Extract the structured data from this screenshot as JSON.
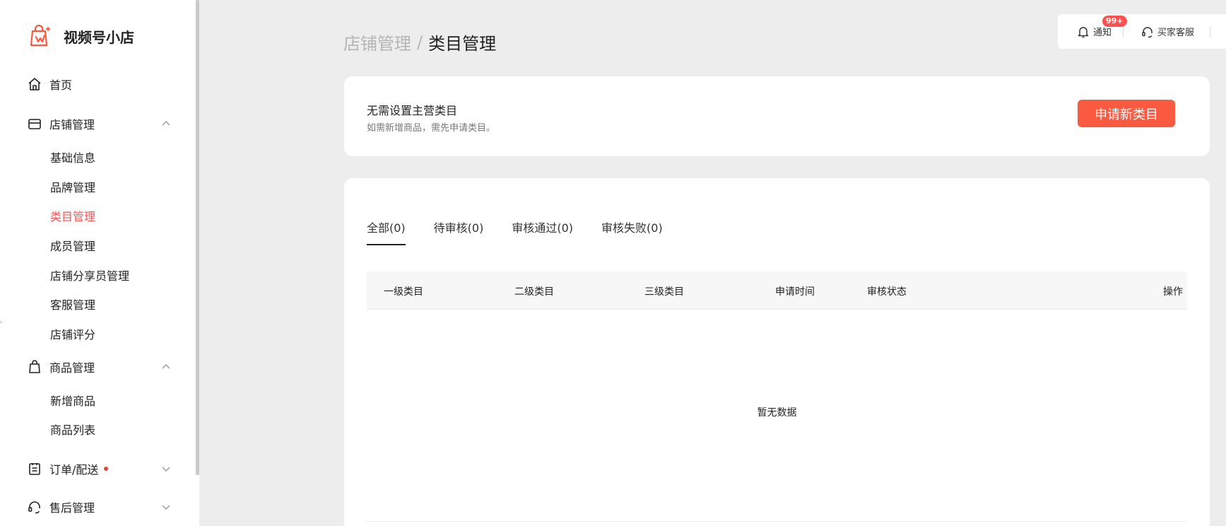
{
  "app": {
    "name": "视频号小店"
  },
  "sidebar": {
    "home": "首页",
    "store": {
      "label": "店铺管理",
      "items": [
        "基础信息",
        "品牌管理",
        "类目管理",
        "成员管理",
        "店铺分享员管理",
        "客服管理",
        "店铺评分"
      ]
    },
    "product": {
      "label": "商品管理",
      "items": [
        "新增商品",
        "商品列表"
      ]
    },
    "orders": {
      "label": "订单/配送"
    },
    "aftersale": {
      "label": "售后管理"
    },
    "active_item": "类目管理"
  },
  "topbar": {
    "notify_label": "通知",
    "notify_badge": "99+",
    "service_label": "买家客服"
  },
  "breadcrumb": {
    "parent": "店铺管理",
    "separator": "/",
    "current": "类目管理"
  },
  "info": {
    "title": "无需设置主营类目",
    "desc": "如需新增商品，需先申请类目。",
    "apply_button": "申请新类目"
  },
  "tabs": [
    "全部(0)",
    "待审核(0)",
    "审核通过(0)",
    "审核失败(0)"
  ],
  "table": {
    "columns": [
      "一级类目",
      "二级类目",
      "三级类目",
      "申请时间",
      "审核状态",
      "操作"
    ],
    "empty_text": "暂无数据"
  },
  "colors": {
    "accent": "#fa5a40",
    "active_text": "#fa5151",
    "badge": "#fa5151"
  }
}
